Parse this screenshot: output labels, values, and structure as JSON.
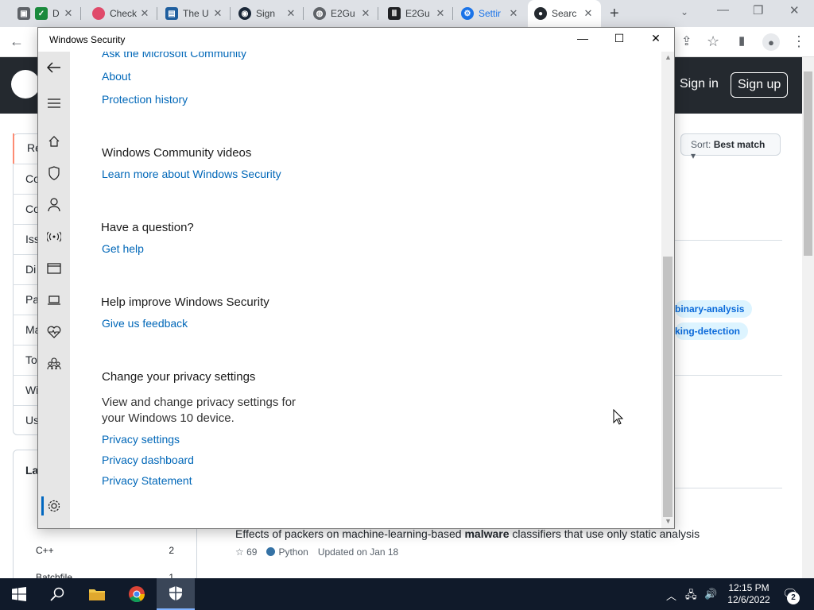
{
  "browser": {
    "tabs": [
      {
        "label": "D",
        "favicon": "gmail-check-icon",
        "color": "#1a8a3c"
      },
      {
        "label": "Check",
        "favicon": "colorful-wheel-icon",
        "color": "#e04a6a"
      },
      {
        "label": "The U",
        "favicon": "chart-icon",
        "color": "#1f5f9f"
      },
      {
        "label": "Sign",
        "favicon": "steam-icon",
        "color": "#1b2838"
      },
      {
        "label": "E2Gu",
        "favicon": "globe-icon",
        "color": "#5f6368"
      },
      {
        "label": "E2Gu",
        "favicon": "library-icon",
        "color": "#202124"
      },
      {
        "label": "Settir",
        "favicon": "gear-icon",
        "color": "#1a73e8"
      },
      {
        "label": "Searc",
        "favicon": "github-icon",
        "color": "#24292f"
      }
    ],
    "new_tab": "+",
    "tab_menu": "⌄",
    "window_controls": {
      "minimize": "—",
      "restore": "❐",
      "close": "✕"
    },
    "toolbar": {
      "back": "←",
      "share": "⇪",
      "star": "☆",
      "sidebar": "▮",
      "menu": "⋮",
      "avatar": "●"
    }
  },
  "github": {
    "sign_in": "Sign in",
    "sign_up": "Sign up",
    "filter_items": [
      "Re",
      "Co",
      "Co",
      "Iss",
      "Di",
      "Pa",
      "Ma",
      "To",
      "Wi",
      "Us"
    ],
    "languages_title": "La",
    "languages": [
      {
        "name": "C++",
        "count": "2"
      },
      {
        "name": "Batchfile",
        "count": "1"
      }
    ],
    "sort_label": "Sort:",
    "sort_value": "Best match",
    "topics": [
      "binary-analysis",
      "king-detection"
    ],
    "result_desc_before": "Effects of packers on machine-learning-based ",
    "result_desc_bold": "malware",
    "result_desc_after": " classifiers that use only static analysis",
    "result_stars": "69",
    "result_language": "Python",
    "result_updated": "Updated on Jan 18"
  },
  "windows_security": {
    "title": "Windows Security",
    "controls": {
      "minimize": "—",
      "maximize": "☐",
      "close": "✕"
    },
    "links_top": [
      "Ask the Microsoft Community",
      "About",
      "Protection history"
    ],
    "community_heading": "Windows Community videos",
    "community_link": "Learn more about Windows Security",
    "question_heading": "Have a question?",
    "question_link": "Get help",
    "improve_heading": "Help improve Windows Security",
    "improve_link": "Give us feedback",
    "privacy_heading": "Change your privacy settings",
    "privacy_body": "View and change privacy settings for your Windows 10 device.",
    "privacy_links": [
      "Privacy settings",
      "Privacy dashboard",
      "Privacy Statement"
    ]
  },
  "taskbar": {
    "time": "12:15 PM",
    "date": "12/6/2022",
    "notifications": "2"
  }
}
